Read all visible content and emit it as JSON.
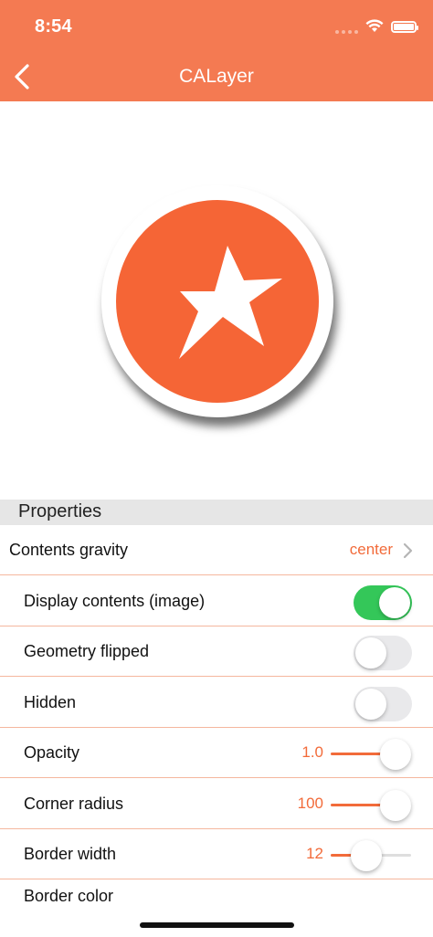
{
  "status_bar": {
    "time": "8:54"
  },
  "nav": {
    "title": "CALayer"
  },
  "section": {
    "title": "Properties"
  },
  "rows": {
    "contents_gravity": {
      "label": "Contents gravity",
      "value": "center"
    },
    "display_contents": {
      "label": "Display contents (image)",
      "on": true
    },
    "geometry_flipped": {
      "label": "Geometry flipped",
      "on": false
    },
    "hidden": {
      "label": "Hidden",
      "on": false
    },
    "opacity": {
      "label": "Opacity",
      "value": "1.0",
      "fraction": 1.0
    },
    "corner_radius": {
      "label": "Corner radius",
      "value": "100",
      "fraction": 1.0
    },
    "border_width": {
      "label": "Border width",
      "value": "12",
      "fraction": 0.55
    },
    "border_color": {
      "label": "Border color"
    }
  },
  "colors": {
    "accent": "#F47A52",
    "layer_fill": "#F56536",
    "toggle_on": "#34C759"
  },
  "icons": {
    "back": "chevron-left-icon",
    "disclosure": "chevron-right-icon",
    "layer_content": "star-icon"
  }
}
